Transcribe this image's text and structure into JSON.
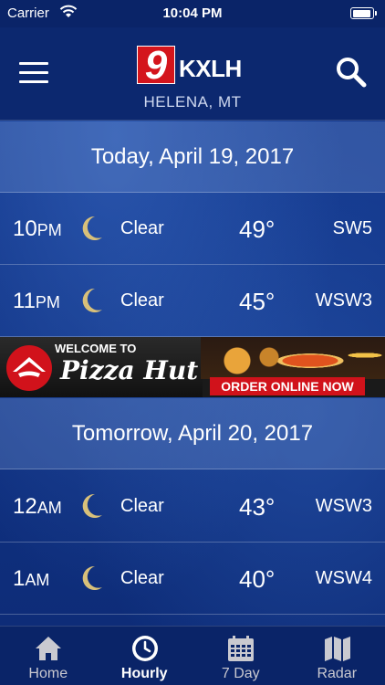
{
  "status_bar": {
    "carrier": "Carrier",
    "time": "10:04 PM"
  },
  "header": {
    "logo_number": "9",
    "logo_callsign": "KXLH",
    "location": "HELENA, MT",
    "menu_icon": "hamburger-menu-icon",
    "search_icon": "search-icon"
  },
  "days": [
    {
      "label": "Today, April 19, 2017",
      "hours": [
        {
          "hour": "10",
          "ampm": "PM",
          "icon": "moon-icon",
          "condition": "Clear",
          "temp": "49°",
          "wind": "SW5"
        },
        {
          "hour": "11",
          "ampm": "PM",
          "icon": "moon-icon",
          "condition": "Clear",
          "temp": "45°",
          "wind": "WSW3"
        }
      ]
    },
    {
      "label": "Tomorrow, April 20, 2017",
      "hours": [
        {
          "hour": "12",
          "ampm": "AM",
          "icon": "moon-icon",
          "condition": "Clear",
          "temp": "43°",
          "wind": "WSW3"
        },
        {
          "hour": "1",
          "ampm": "AM",
          "icon": "moon-icon",
          "condition": "Clear",
          "temp": "40°",
          "wind": "WSW4"
        }
      ]
    }
  ],
  "ad": {
    "welcome": "WELCOME TO",
    "brand": "Pizza Hut",
    "cta": "ORDER ONLINE NOW"
  },
  "tabs": [
    {
      "label": "Home",
      "icon": "home-icon",
      "active": false
    },
    {
      "label": "Hourly",
      "icon": "clock-icon",
      "active": true
    },
    {
      "label": "7 Day",
      "icon": "calendar-icon",
      "active": false
    },
    {
      "label": "Radar",
      "icon": "map-icon",
      "active": false
    }
  ],
  "colors": {
    "background": "#103283",
    "brand_red": "#d4151c",
    "moon": "#d8c07a"
  }
}
